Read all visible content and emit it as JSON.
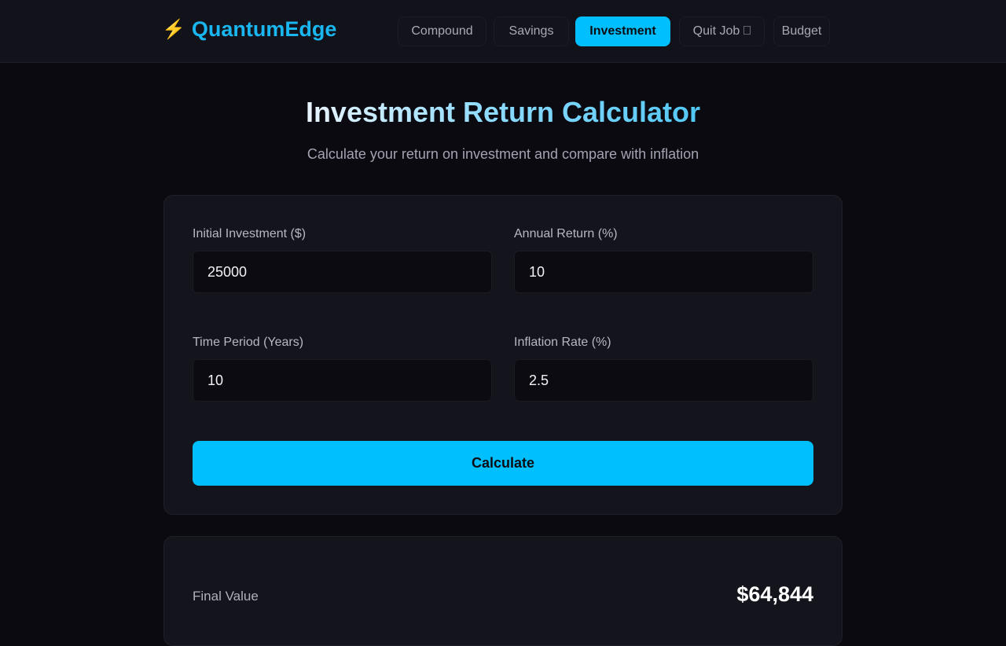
{
  "brand": {
    "icon": "lightning-bolt-icon",
    "glyph": "⚡",
    "name": "QuantumEdge",
    "color": "#1ab6f0"
  },
  "nav": {
    "items": [
      {
        "label": "Compound"
      },
      {
        "label": "Savings"
      },
      {
        "label": "Investment",
        "active": true
      },
      {
        "label": "Quit Job ⎕"
      },
      {
        "label": "Budget"
      }
    ]
  },
  "page": {
    "title": "Investment Return Calculator",
    "subtitle": "Calculate your return on investment and compare with inflation"
  },
  "form": {
    "initial_investment": {
      "label": "Initial Investment ($)",
      "value": "25000"
    },
    "annual_return": {
      "label": "Annual Return (%)",
      "value": "10"
    },
    "time_period": {
      "label": "Time Period (Years)",
      "value": "10"
    },
    "inflation_rate": {
      "label": "Inflation Rate (%)",
      "value": "2.5"
    },
    "calculate_label": "Calculate"
  },
  "results": {
    "final_value": {
      "label": "Final Value",
      "value": "$64,844"
    }
  },
  "colors": {
    "accent": "#00bfff",
    "background": "#0b0a10",
    "card": "#14141c"
  }
}
